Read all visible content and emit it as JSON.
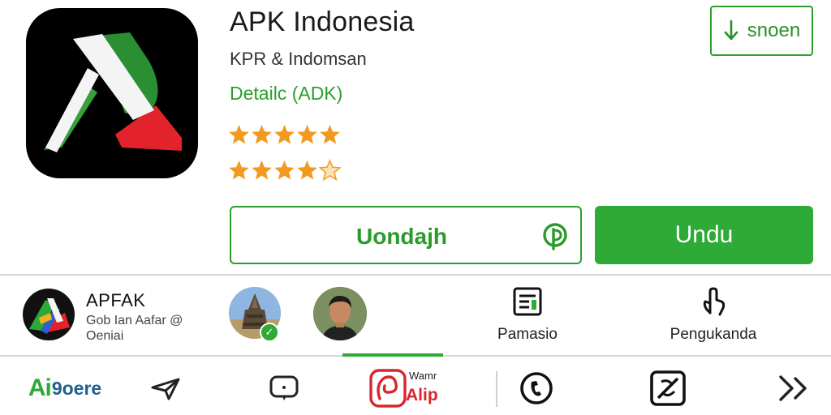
{
  "app": {
    "title": "APK Indonesia",
    "developer": "KPR & Indomsan",
    "detail_link": "Detailc (ADK)",
    "rating_rows": [
      5,
      4
    ]
  },
  "top_button": {
    "label": "snoen",
    "icon": "download-arrow-icon"
  },
  "actions": {
    "secondary_label": "Uondajh",
    "secondary_icon": "pinterest-like-icon",
    "primary_label": "Undu"
  },
  "related": {
    "title": "APFAK",
    "subtitle_line1": "Gob Ian Aafar @",
    "subtitle_line2": "Oeniai"
  },
  "stats": [
    {
      "label": "Pamasio",
      "icon": "news-list-icon"
    },
    {
      "label": "Pengukanda",
      "icon": "tap-hand-icon"
    }
  ],
  "tabs": {
    "brand_part1": "Ai",
    "brand_part2": "9oere",
    "active_top": "Wamr",
    "active_bottom": "Alip",
    "icons": [
      "send-icon",
      "chat-icon",
      "active-app-icon",
      "phone-icon",
      "no-access-icon",
      "chevron-right-double-icon"
    ]
  },
  "colors": {
    "accent_green": "#2eaa36",
    "star_orange": "#f29a1f",
    "active_red": "#d8262c"
  }
}
